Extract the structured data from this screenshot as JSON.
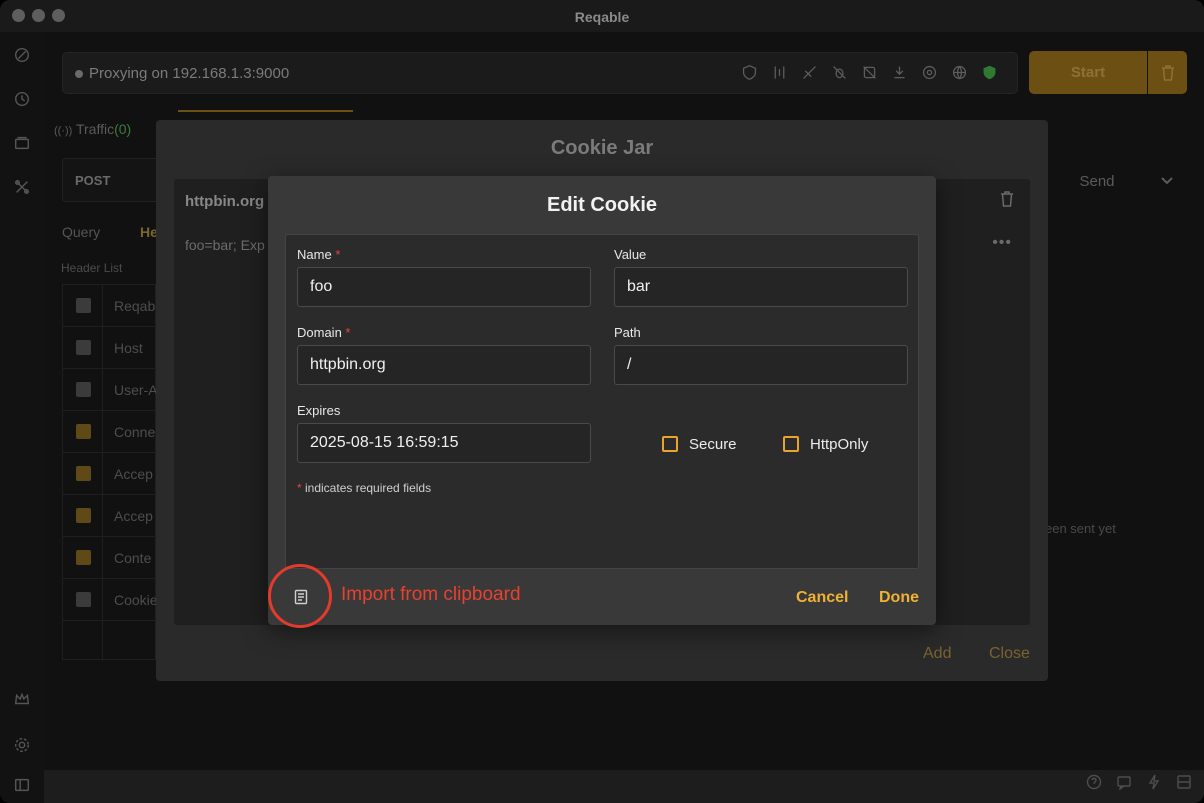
{
  "window": {
    "title": "Reqable"
  },
  "proxy": {
    "status": "Proxying on 192.168.1.3:9000",
    "start_label": "Start"
  },
  "traffic_tab": {
    "label": "Traffic",
    "count": "(0)"
  },
  "request": {
    "method": "POST",
    "send_label": "Send",
    "tabs": [
      "Query",
      "He"
    ],
    "header_list_label": "Header List",
    "headers": [
      {
        "name": "Reqab",
        "checked": true
      },
      {
        "name": "Host",
        "checked": true
      },
      {
        "name": "User-A",
        "checked": true
      },
      {
        "name": "Conne",
        "checked": true
      },
      {
        "name": "Accep",
        "checked": true
      },
      {
        "name": "Accep",
        "checked": true
      },
      {
        "name": "Conte",
        "checked": true
      },
      {
        "name": "Cookie",
        "checked": true
      }
    ],
    "response_hint": "een sent yet"
  },
  "cookie_jar": {
    "title": "Cookie Jar",
    "domain": "httpbin.org",
    "cookie_summary": "foo=bar; Exp",
    "add_label": "Add",
    "close_label": "Close"
  },
  "edit_cookie": {
    "title": "Edit Cookie",
    "name_label": "Name",
    "name_value": "foo",
    "value_label": "Value",
    "value_value": "bar",
    "domain_label": "Domain",
    "domain_value": "httpbin.org",
    "path_label": "Path",
    "path_value": "/",
    "expires_label": "Expires",
    "expires_value": "2025-08-15 16:59:15",
    "secure_label": "Secure",
    "httponly_label": "HttpOnly",
    "required_star": "*",
    "required_note": " indicates required fields",
    "cancel_label": "Cancel",
    "done_label": "Done"
  },
  "annotation": {
    "text": "Import from clipboard"
  },
  "colors": {
    "accent": "#eeb236",
    "required": "#e5453a",
    "annotation": "#e23b2c"
  }
}
